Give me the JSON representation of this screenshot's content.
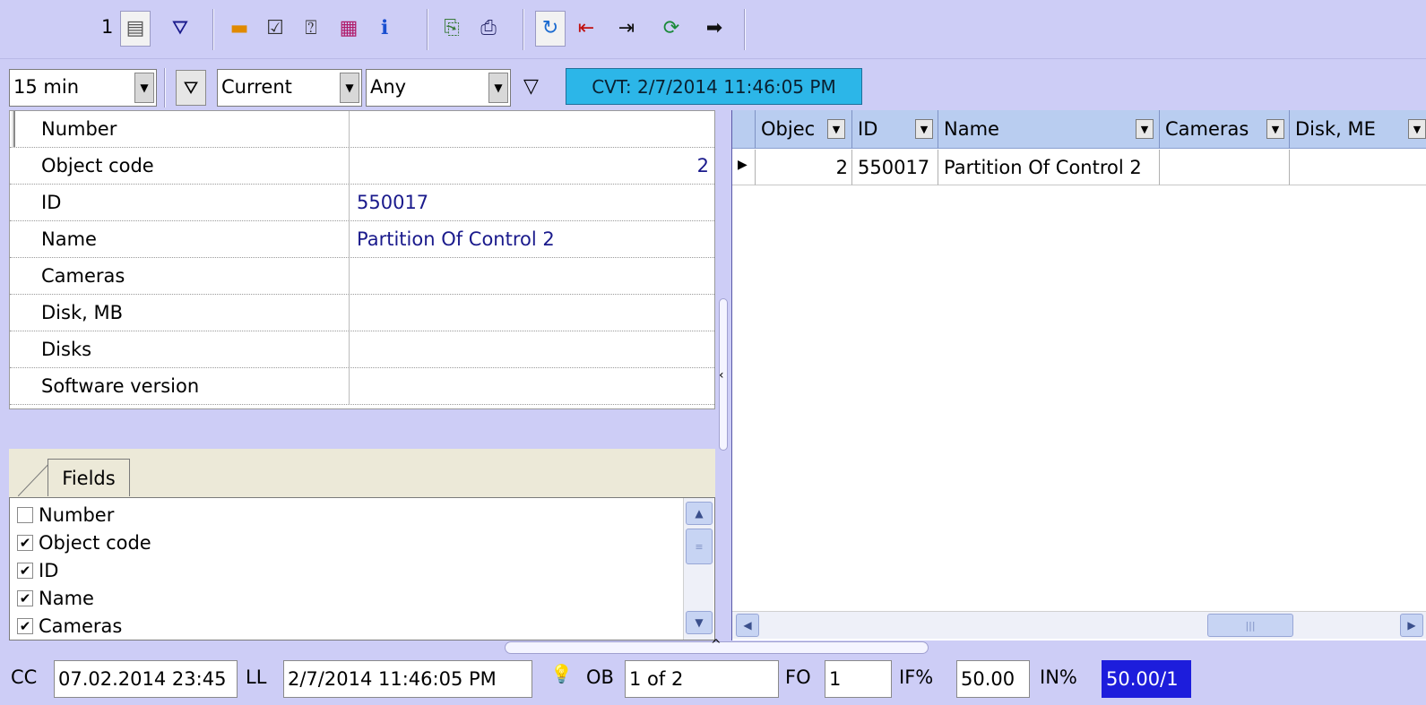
{
  "toolbar": {
    "page_number": "1",
    "buttons": [
      {
        "icon": "table-view-icon",
        "glyph": "▤",
        "color": "#555555",
        "pressed": true
      },
      {
        "icon": "filter-funnel-icon",
        "glyph": "⛛",
        "color": "#1a1a8c",
        "pressed": false
      },
      {
        "icon": "layers-icon",
        "glyph": "▬",
        "color": "#e08a00",
        "pressed": false
      },
      {
        "icon": "checklist-icon",
        "glyph": "☑",
        "color": "#333333",
        "pressed": false
      },
      {
        "icon": "help-card-icon",
        "glyph": "⍰",
        "color": "#333333",
        "pressed": false
      },
      {
        "icon": "color-bars-icon",
        "glyph": "▦",
        "color": "#b01a6a",
        "pressed": false
      },
      {
        "icon": "info-icon",
        "glyph": "ℹ",
        "color": "#1a4fd0",
        "pressed": false
      },
      {
        "icon": "export-icon",
        "glyph": "⎘",
        "color": "#3a7a3a",
        "pressed": false
      },
      {
        "icon": "print-icon",
        "glyph": "⎙",
        "color": "#2a2a6a",
        "pressed": false
      },
      {
        "icon": "refresh-icon",
        "glyph": "↻",
        "color": "#1a6ad0",
        "pressed": true
      },
      {
        "icon": "first-record-icon",
        "glyph": "⇤",
        "color": "#c01010",
        "pressed": false
      },
      {
        "icon": "jump-to-icon",
        "glyph": "⇥",
        "color": "#111111",
        "pressed": false
      },
      {
        "icon": "sync-icon",
        "glyph": "⟳",
        "color": "#1a8a3a",
        "pressed": false
      },
      {
        "icon": "next-arrow-icon",
        "glyph": "➡",
        "color": "#111111",
        "pressed": false
      }
    ]
  },
  "filters": {
    "interval": "15 min",
    "period": "Current",
    "scope": "Any",
    "cvt": "CVT: 2/7/2014 11:46:05 PM"
  },
  "properties": [
    {
      "label": "Number",
      "value": "",
      "align": "left"
    },
    {
      "label": "Object code",
      "value": "2",
      "align": "right"
    },
    {
      "label": "ID",
      "value": "550017",
      "align": "left"
    },
    {
      "label": "Name",
      "value": "Partition Of Control 2",
      "align": "left"
    },
    {
      "label": "Cameras",
      "value": "",
      "align": "left"
    },
    {
      "label": "Disk, MB",
      "value": "",
      "align": "left"
    },
    {
      "label": "Disks",
      "value": "",
      "align": "left"
    },
    {
      "label": "Software version",
      "value": "",
      "align": "left"
    }
  ],
  "fields_tab": {
    "label": "Fields",
    "items": [
      {
        "label": "Number",
        "checked": false
      },
      {
        "label": "Object code",
        "checked": true
      },
      {
        "label": "ID",
        "checked": true
      },
      {
        "label": "Name",
        "checked": true
      },
      {
        "label": "Cameras",
        "checked": true
      }
    ]
  },
  "grid": {
    "columns": [
      "Objec",
      "ID",
      "Name",
      "Cameras",
      "Disk, ME"
    ],
    "rows": [
      [
        "2",
        "550017",
        "Partition Of Control 2",
        "",
        ""
      ]
    ]
  },
  "status": {
    "cc_label": "CC",
    "cc_value": "07.02.2014 23:45",
    "ll_label": "LL",
    "ll_value": "2/7/2014 11:46:05 PM",
    "ob_label": "OB",
    "ob_value": "1 of 2",
    "fo_label": "FO",
    "fo_value": "1",
    "if_label": "IF%",
    "if_value": "50.00",
    "in_label": "IN%",
    "in_value": "50.00/1"
  }
}
